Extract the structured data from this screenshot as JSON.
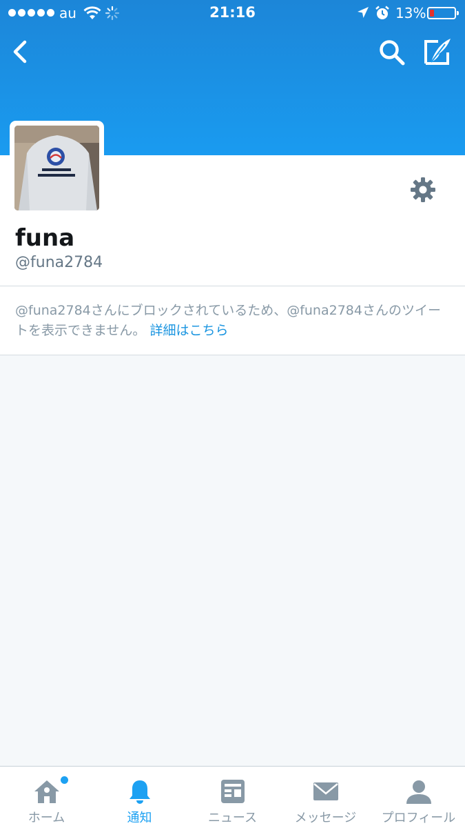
{
  "status_bar": {
    "carrier": "au",
    "time": "21:16",
    "battery_percent": "13%",
    "battery_level": 0.13
  },
  "nav": {
    "back_icon": "chevron-left-icon",
    "search_icon": "search-icon",
    "compose_icon": "compose-tweet-icon"
  },
  "profile": {
    "display_name": "funa",
    "handle": "@funa2784",
    "settings_icon": "gear-icon"
  },
  "blocked_notice": {
    "text": "@funa2784さんにブロックされているため、@funa2784さんのツイートを表示できません。",
    "link": "詳細はこちら"
  },
  "tabs": [
    {
      "label": "ホーム",
      "icon": "home-icon",
      "active": false,
      "has_dot": true
    },
    {
      "label": "通知",
      "icon": "bell-icon",
      "active": true,
      "has_dot": false
    },
    {
      "label": "ニュース",
      "icon": "news-icon",
      "active": false,
      "has_dot": false
    },
    {
      "label": "メッセージ",
      "icon": "envelope-icon",
      "active": false,
      "has_dot": false
    },
    {
      "label": "プロフィール",
      "icon": "person-icon",
      "active": false,
      "has_dot": false
    }
  ],
  "colors": {
    "header_blue": "#1a9bf0",
    "accent": "#1da1f2",
    "muted": "#8899a6",
    "background": "#f5f8fa"
  }
}
